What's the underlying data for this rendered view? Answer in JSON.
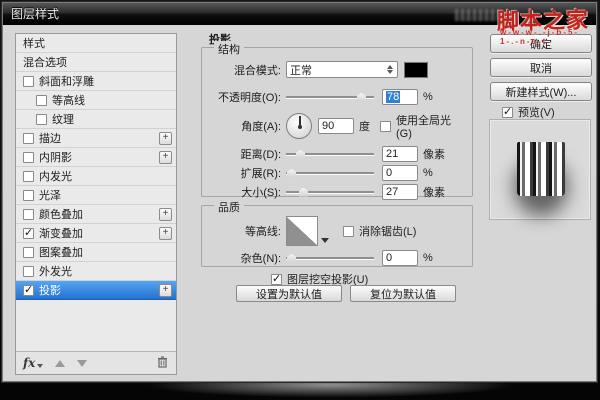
{
  "window": {
    "title": "图层样式"
  },
  "watermark": {
    "brand": "脚本之家",
    "url": "w-w-w-.-j-b-5-1-.-n-e-t"
  },
  "sidebar": {
    "items": [
      {
        "label": "样式"
      },
      {
        "label": "混合选项"
      },
      {
        "label": "斜面和浮雕",
        "checked": false
      },
      {
        "label": "等高线",
        "checked": false
      },
      {
        "label": "纹理",
        "checked": false
      },
      {
        "label": "描边",
        "checked": false,
        "plus": "+"
      },
      {
        "label": "内阴影",
        "checked": false,
        "plus": "+"
      },
      {
        "label": "内发光",
        "checked": false
      },
      {
        "label": "光泽",
        "checked": false
      },
      {
        "label": "颜色叠加",
        "checked": false,
        "plus": "+"
      },
      {
        "label": "渐变叠加",
        "checked": true,
        "plus": "+"
      },
      {
        "label": "图案叠加",
        "checked": false
      },
      {
        "label": "外发光",
        "checked": false
      },
      {
        "label": "投影",
        "checked": true,
        "plus": "+",
        "selected": true
      }
    ],
    "fx_label": "fx"
  },
  "main": {
    "title": "投影",
    "structure": {
      "legend": "结构",
      "blend_mode_label": "混合模式:",
      "blend_mode_value": "正常",
      "opacity_label": "不透明度(O):",
      "opacity_value": "78",
      "opacity_unit": "%",
      "angle_label": "角度(A):",
      "angle_value": "90",
      "angle_unit": "度",
      "global_light_label": "使用全局光(G)",
      "distance_label": "距离(D):",
      "distance_value": "21",
      "distance_unit": "像素",
      "spread_label": "扩展(R):",
      "spread_value": "0",
      "spread_unit": "%",
      "size_label": "大小(S):",
      "size_value": "27",
      "size_unit": "像素"
    },
    "quality": {
      "legend": "品质",
      "contour_label": "等高线:",
      "antialias_label": "消除锯齿(L)",
      "noise_label": "杂色(N):",
      "noise_value": "0",
      "noise_unit": "%"
    },
    "knockout_label": "图层挖空投影(U)",
    "make_default_label": "设置为默认值",
    "reset_default_label": "复位为默认值"
  },
  "actions": {
    "ok": "确定",
    "cancel": "取消",
    "new_style": "新建样式(W)...",
    "preview": "预览(V)"
  },
  "colors": {
    "selection_blue": "#2f7fd6",
    "swatch_black": "#000000",
    "watermark_red": "#c2221c"
  }
}
